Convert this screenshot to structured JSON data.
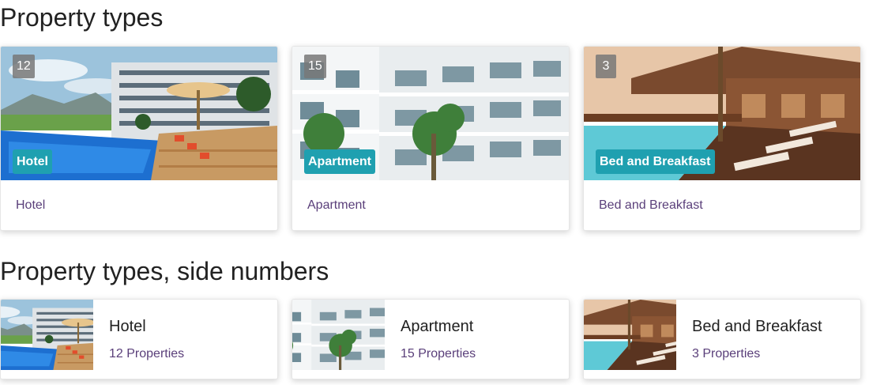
{
  "sections": {
    "grid_title": "Property types",
    "list_title": "Property types, side numbers"
  },
  "grid_cards": [
    {
      "count": "12",
      "tag": "Hotel",
      "label": "Hotel",
      "image": "hotel-pool-photo"
    },
    {
      "count": "15",
      "tag": "Apartment",
      "label": "Apartment",
      "image": "apartment-courtyard-photo"
    },
    {
      "count": "3",
      "tag": "Bed and Breakfast",
      "label": "Bed and Breakfast",
      "image": "bnb-deck-photo"
    }
  ],
  "list_cards": [
    {
      "name": "Hotel",
      "properties": "12 Properties",
      "image": "hotel-pool-photo"
    },
    {
      "name": "Apartment",
      "properties": "15 Properties",
      "image": "apartment-courtyard-photo"
    },
    {
      "name": "Bed and Breakfast",
      "properties": "3 Properties",
      "image": "bnb-deck-photo"
    }
  ],
  "colors": {
    "tag_background": "#1fa0b0",
    "link_text": "#5a3f7a",
    "badge_background": "#787878"
  }
}
